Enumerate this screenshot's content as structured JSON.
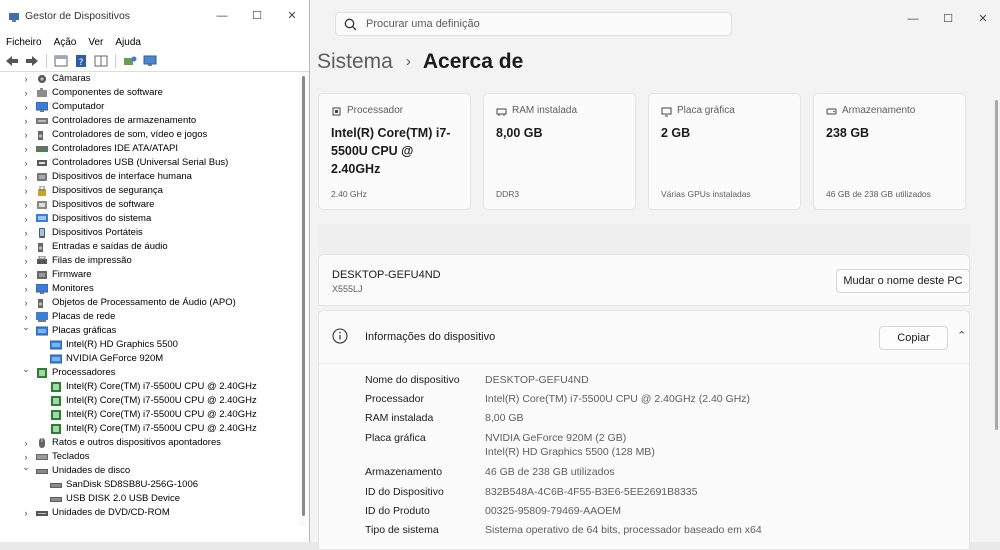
{
  "device_manager": {
    "title": "Gestor de Dispositivos",
    "menu": [
      "Ficheiro",
      "Ação",
      "Ver",
      "Ajuda"
    ],
    "tree": [
      {
        "label": "Câmaras",
        "level": 1,
        "expanded": false,
        "icon": "camera-icon"
      },
      {
        "label": "Componentes de software",
        "level": 1,
        "expanded": false,
        "icon": "puzzle-icon"
      },
      {
        "label": "Computador",
        "level": 1,
        "expanded": false,
        "icon": "monitor-icon"
      },
      {
        "label": "Controladores de armazenamento",
        "level": 1,
        "expanded": false,
        "icon": "storage-controller-icon"
      },
      {
        "label": "Controladores de som, vídeo e jogos",
        "level": 1,
        "expanded": false,
        "icon": "speaker-icon"
      },
      {
        "label": "Controladores IDE ATA/ATAPI",
        "level": 1,
        "expanded": false,
        "icon": "ide-icon"
      },
      {
        "label": "Controladores USB (Universal Serial Bus)",
        "level": 1,
        "expanded": false,
        "icon": "usb-icon"
      },
      {
        "label": "Dispositivos de interface humana",
        "level": 1,
        "expanded": false,
        "icon": "hid-icon"
      },
      {
        "label": "Dispositivos de segurança",
        "level": 1,
        "expanded": false,
        "icon": "security-icon"
      },
      {
        "label": "Dispositivos de software",
        "level": 1,
        "expanded": false,
        "icon": "software-device-icon"
      },
      {
        "label": "Dispositivos do sistema",
        "level": 1,
        "expanded": false,
        "icon": "system-device-icon"
      },
      {
        "label": "Dispositivos Portáteis",
        "level": 1,
        "expanded": false,
        "icon": "portable-icon"
      },
      {
        "label": "Entradas e saídas de áudio",
        "level": 1,
        "expanded": false,
        "icon": "speaker-icon"
      },
      {
        "label": "Filas de impressão",
        "level": 1,
        "expanded": false,
        "icon": "printer-icon"
      },
      {
        "label": "Firmware",
        "level": 1,
        "expanded": false,
        "icon": "firmware-icon"
      },
      {
        "label": "Monitores",
        "level": 1,
        "expanded": false,
        "icon": "monitor-icon"
      },
      {
        "label": "Objetos de Processamento de Áudio (APO)",
        "level": 1,
        "expanded": false,
        "icon": "speaker-icon"
      },
      {
        "label": "Placas de rede",
        "level": 1,
        "expanded": false,
        "icon": "network-icon"
      },
      {
        "label": "Placas gráficas",
        "level": 1,
        "expanded": true,
        "icon": "display-adapter-icon"
      },
      {
        "label": "Intel(R) HD Graphics 5500",
        "level": 2,
        "icon": "display-adapter-icon"
      },
      {
        "label": "NVIDIA GeForce 920M",
        "level": 2,
        "icon": "display-adapter-icon"
      },
      {
        "label": "Processadores",
        "level": 1,
        "expanded": true,
        "icon": "processor-icon"
      },
      {
        "label": "Intel(R) Core(TM) i7-5500U CPU @ 2.40GHz",
        "level": 2,
        "icon": "processor-icon"
      },
      {
        "label": "Intel(R) Core(TM) i7-5500U CPU @ 2.40GHz",
        "level": 2,
        "icon": "processor-icon"
      },
      {
        "label": "Intel(R) Core(TM) i7-5500U CPU @ 2.40GHz",
        "level": 2,
        "icon": "processor-icon"
      },
      {
        "label": "Intel(R) Core(TM) i7-5500U CPU @ 2.40GHz",
        "level": 2,
        "icon": "processor-icon"
      },
      {
        "label": "Ratos e outros dispositivos apontadores",
        "level": 1,
        "expanded": false,
        "icon": "mouse-icon"
      },
      {
        "label": "Teclados",
        "level": 1,
        "expanded": false,
        "icon": "keyboard-icon"
      },
      {
        "label": "Unidades de disco",
        "level": 1,
        "expanded": true,
        "icon": "disk-drive-icon"
      },
      {
        "label": "SanDisk SD8SB8U-256G-1006",
        "level": 2,
        "icon": "disk-drive-icon"
      },
      {
        "label": "USB DISK 2.0 USB Device",
        "level": 2,
        "icon": "disk-drive-icon"
      },
      {
        "label": "Unidades de DVD/CD-ROM",
        "level": 1,
        "expanded": false,
        "icon": "dvd-icon"
      }
    ]
  },
  "settings": {
    "search": {
      "placeholder": "Procurar uma definição"
    },
    "breadcrumb": {
      "parent": "Sistema",
      "separator": "›",
      "current": "Acerca de"
    },
    "cards": [
      {
        "label": "Processador",
        "value": "Intel(R) Core(TM) i7-5500U CPU @ 2.40GHz",
        "sub": "2.40 GHz",
        "icon": "processor-icon"
      },
      {
        "label": "RAM instalada",
        "value": "8,00 GB",
        "sub": "DDR3",
        "icon": "ram-icon"
      },
      {
        "label": "Placa gráfica",
        "value": "2 GB",
        "sub": "Várias GPUs instaladas",
        "icon": "gpu-icon"
      },
      {
        "label": "Armazenamento",
        "value": "238 GB",
        "sub": "46 GB de 238 GB utilizados",
        "icon": "storage-icon"
      }
    ],
    "device": {
      "name": "DESKTOP-GEFU4ND",
      "model": "X555LJ",
      "rename_button": "Mudar o nome deste PC"
    },
    "device_info": {
      "title": "Informações do dispositivo",
      "copy_button": "Copiar",
      "rows": [
        {
          "key": "Nome do dispositivo",
          "value": "DESKTOP-GEFU4ND"
        },
        {
          "key": "Processador",
          "value": "Intel(R) Core(TM) i7-5500U CPU @ 2.40GHz   (2.40 GHz)"
        },
        {
          "key": "RAM instalada",
          "value": "8,00 GB"
        },
        {
          "key": "Placa gráfica",
          "value": "NVIDIA GeForce 920M (2 GB)",
          "value2": "Intel(R) HD Graphics 5500 (128 MB)"
        },
        {
          "key": "Armazenamento",
          "value": "46 GB de 238 GB utilizados"
        },
        {
          "key": "ID do Dispositivo",
          "value": "832B548A-4C6B-4F55-B3E6-5EE2691B8335"
        },
        {
          "key": "ID do Produto",
          "value": "00325-95809-79469-AAOEM"
        },
        {
          "key": "Tipo de sistema",
          "value": "Sistema operativo de 64 bits, processador baseado em x64"
        }
      ]
    }
  }
}
